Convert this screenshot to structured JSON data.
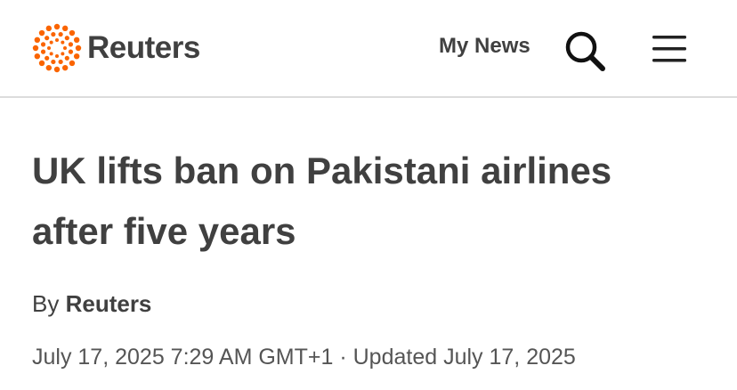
{
  "header": {
    "brand": "Reuters",
    "my_news_label": "My News",
    "accent_color": "#fa6400",
    "icons": [
      "reuters-logo-icon",
      "search-icon",
      "hamburger-menu-icon"
    ]
  },
  "article": {
    "headline": "UK lifts ban on Pakistani airlines after five years",
    "byline_prefix": "By",
    "byline_author": "Reuters",
    "published": "July 17, 2025 7:29 AM GMT+1",
    "separator": "·",
    "updated": "Updated July 17, 2025"
  }
}
